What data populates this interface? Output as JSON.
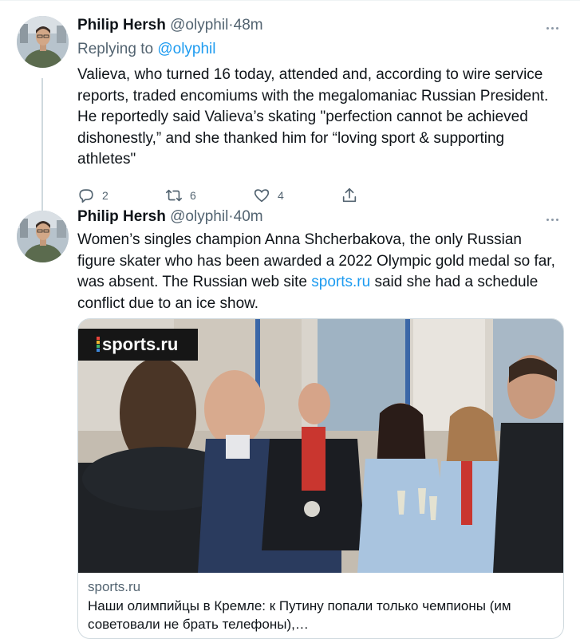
{
  "tweets": [
    {
      "author_name": "Philip Hersh",
      "handle": "@olyphil",
      "separator": "·",
      "time": "48m",
      "replying_prefix": "Replying to",
      "replying_to": "@olyphil",
      "text": "Valieva, who turned 16 today, attended and, according to wire service reports, traded encomiums with the megalomaniac Russian President.  He reportedly said Valieva’s skating \"perfection cannot be achieved dishonestly,” and she thanked him for “loving sport & supporting athletes\"",
      "replies": "2",
      "retweets": "6",
      "likes": "4"
    },
    {
      "author_name": "Philip Hersh",
      "handle": "@olyphil",
      "separator": "·",
      "time": "40m",
      "text_before_link": "Women’s singles champion Anna Shcherbakova, the only Russian figure skater who has been awarded a 2022 Olympic gold medal so far, was absent.  The Russian web site ",
      "link_text": "sports.ru",
      "text_after_link": " said she had a schedule conflict due to an ice show.",
      "card": {
        "brand": "sports.ru",
        "domain": "sports.ru",
        "title": "Наши олимпийцы в Кремле: к Путину попали только чемпионы (им советовали не брать телефоны),…"
      }
    }
  ],
  "colors": {
    "link": "#1d9bf0",
    "secondary_text": "#536471",
    "primary_text": "#0f1419",
    "border": "#cfd9de"
  },
  "icons": [
    "more-icon",
    "reply-icon",
    "retweet-icon",
    "like-icon",
    "share-icon"
  ]
}
